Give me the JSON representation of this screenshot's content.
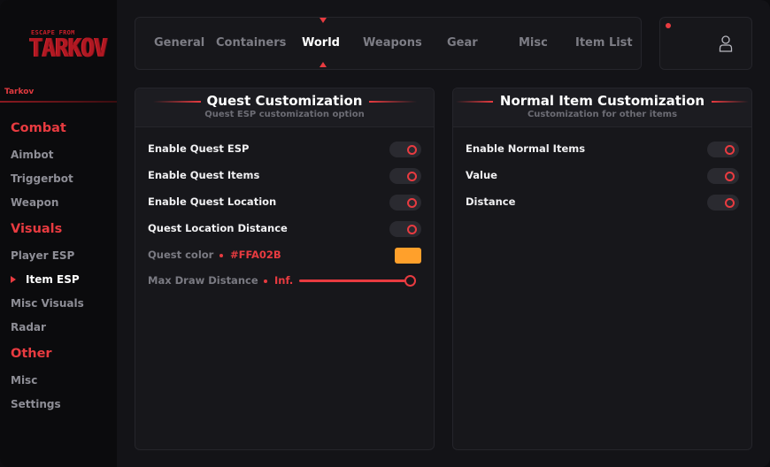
{
  "sidebar": {
    "logo_line1": "ESCAPE FROM",
    "logo_line2": "TARKOV",
    "game_label": "Tarkov",
    "sections": [
      {
        "title": "Combat",
        "items": [
          "Aimbot",
          "Triggerbot",
          "Weapon"
        ]
      },
      {
        "title": "Visuals",
        "items": [
          "Player ESP",
          "Item ESP",
          "Misc Visuals",
          "Radar"
        ]
      },
      {
        "title": "Other",
        "items": [
          "Misc",
          "Settings"
        ]
      }
    ],
    "active_item": "Item ESP"
  },
  "tabs": {
    "items": [
      "General",
      "Containers",
      "World",
      "Weapons",
      "Gear",
      "Misc",
      "Item List"
    ],
    "active": "World"
  },
  "user": {
    "icon": "user-icon",
    "status_icon": "status-dot"
  },
  "quest_panel": {
    "title": "Quest Customization",
    "subtitle": "Quest ESP customization option",
    "toggles": [
      {
        "label": "Enable Quest ESP",
        "on": true
      },
      {
        "label": "Enable Quest Items",
        "on": true
      },
      {
        "label": "Enable Quest Location",
        "on": true
      },
      {
        "label": "Quest Location Distance",
        "on": true
      }
    ],
    "color_label": "Quest color",
    "color_value": "#FFA02B",
    "slider_label": "Max Draw Distance",
    "slider_value": "Inf.",
    "slider_fraction": 1.0
  },
  "item_panel": {
    "title": "Normal Item Customization",
    "subtitle": "Customization for other items",
    "toggles": [
      {
        "label": "Enable Normal Items",
        "on": true
      },
      {
        "label": "Value",
        "on": true
      },
      {
        "label": "Distance",
        "on": true
      }
    ]
  },
  "colors": {
    "accent": "#e83b40",
    "quest_swatch": "#FFA02B"
  }
}
